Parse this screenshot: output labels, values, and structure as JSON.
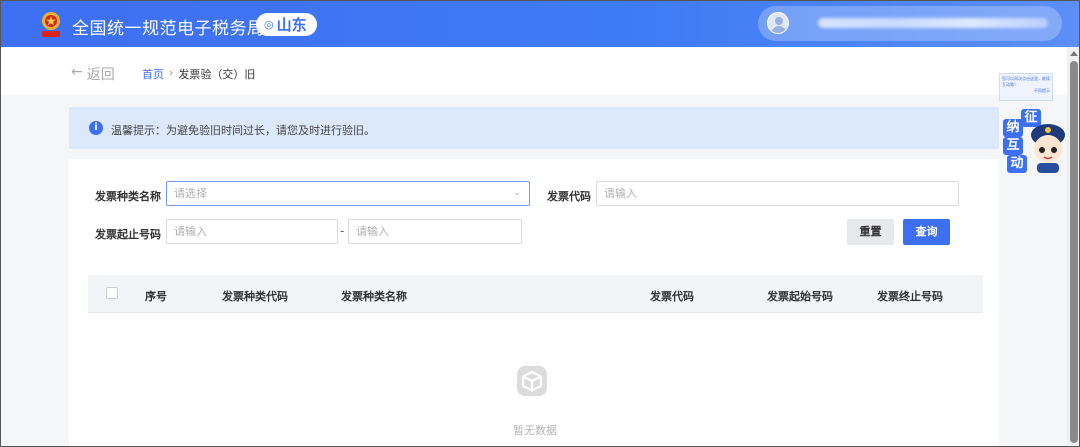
{
  "header": {
    "site_title": "全国统一规范电子税务局",
    "region": "山东",
    "region_icon": "location-pin-icon",
    "brand_color": "#3d6ff2"
  },
  "nav": {
    "back_label": "返回",
    "breadcrumb_home": "首页",
    "breadcrumb_sep": "›",
    "breadcrumb_current": "发票验（交）旧"
  },
  "notice": {
    "text": "温馨提示：为避免验旧时间过长，请您及时进行验旧。"
  },
  "form": {
    "invoice_type_label": "发票种类名称",
    "invoice_type_placeholder": "请选择",
    "invoice_code_label": "发票代码",
    "invoice_code_placeholder": "请输入",
    "number_range_label": "发票起止号码",
    "number_start_placeholder": "请输入",
    "range_dash": "-",
    "number_end_placeholder": "请输入",
    "reset_label": "重置",
    "query_label": "查询"
  },
  "table": {
    "columns": [
      "序号",
      "发票种类代码",
      "发票种类名称",
      "发票代码",
      "发票起始号码",
      "发票终止号码"
    ],
    "rows": [],
    "empty_text": "暂无数据"
  },
  "side_widget": {
    "tip_text": "您可以再次点击这里，继续互动哦！",
    "tip_link": "不再提示",
    "mascot_chars": [
      "征",
      "纳",
      "互",
      "动"
    ]
  }
}
